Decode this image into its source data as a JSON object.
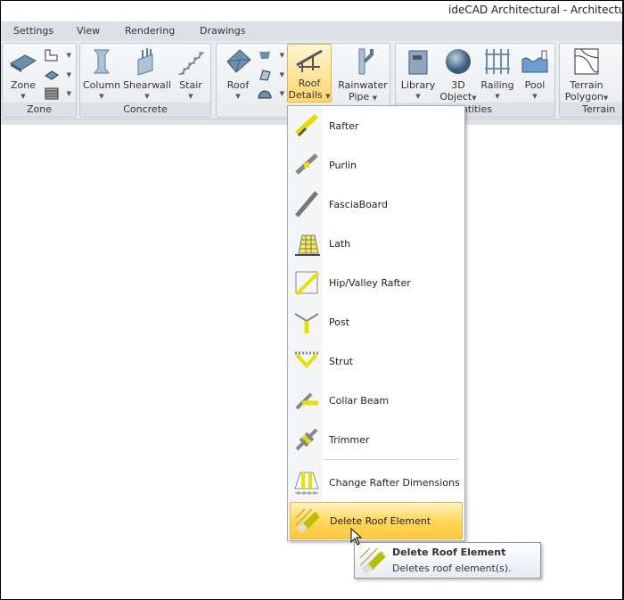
{
  "window": {
    "title": "ideCAD Architectural - Architectural T"
  },
  "tabs": [
    "Settings",
    "View",
    "Rendering",
    "Drawings"
  ],
  "ribbon": {
    "zone": {
      "label": "Zone",
      "buttons": {
        "zone": "Zone"
      }
    },
    "concrete": {
      "label": "Concrete",
      "buttons": {
        "column": "Column",
        "shearwall": "Shearwall",
        "stair": "Stair"
      }
    },
    "roof": {
      "buttons": {
        "roof": "Roof",
        "roof_details_1": "Roof",
        "roof_details_2": "Details",
        "rainwater_1": "Rainwater",
        "rainwater_2": "Pipe"
      }
    },
    "entities": {
      "label": "ntities",
      "buttons": {
        "library": "Library",
        "object_1": "3D",
        "object_2": "Object",
        "railing": "Railing",
        "pool": "Pool"
      }
    },
    "terrain": {
      "label": "Terrain",
      "buttons": {
        "terrain_1": "Terrain",
        "terrain_2": "Polygon"
      }
    }
  },
  "menu": {
    "items": [
      "Rafter",
      "Purlin",
      "FasciaBoard",
      "Lath",
      "Hip/Valley Rafter",
      "Post",
      "Strut",
      "Collar Beam",
      "Trimmer",
      "Change Rafter Dimensions",
      "Delete Roof Element"
    ],
    "hovered": "Delete Roof Element"
  },
  "tooltip": {
    "title": "Delete Roof Element",
    "description": "Deletes roof element(s)."
  },
  "colors": {
    "accent": "#ffd75a",
    "icon_yellow": "#f0e000"
  }
}
